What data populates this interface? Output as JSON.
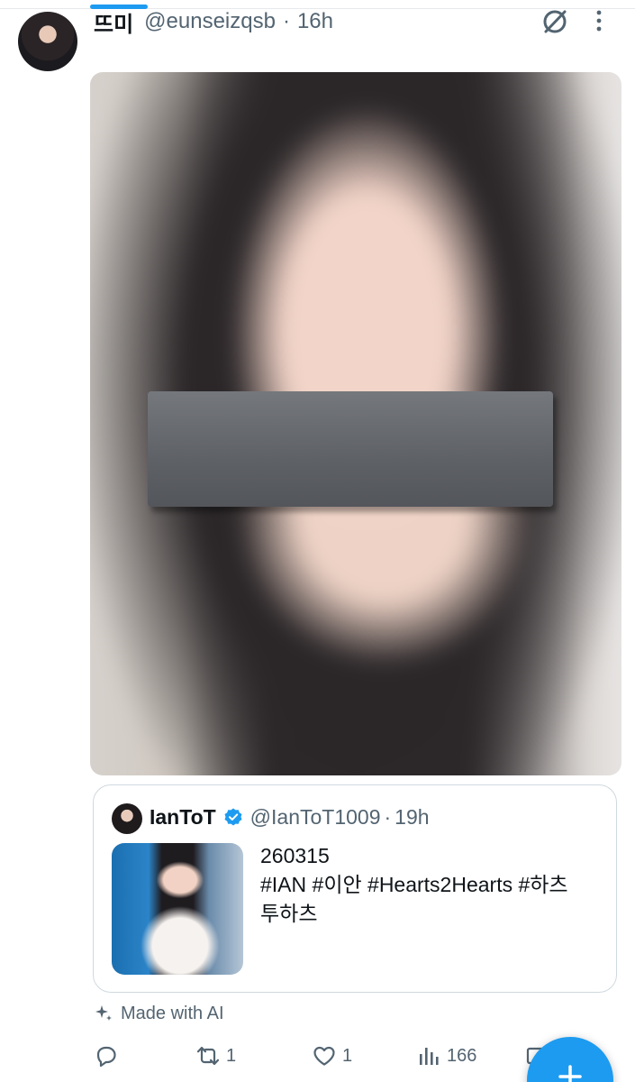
{
  "tweet": {
    "display_name": "뜨미",
    "handle": "@eunseizqsb",
    "separator": "·",
    "time": "16h",
    "avatar_icon": "profile-avatar",
    "menu_icons": [
      "grok-icon",
      "more-vertical-icon"
    ]
  },
  "media": {
    "description_icon": "blurred-photo",
    "censor_color": "#5e6166"
  },
  "quote": {
    "display_name": "IanToT",
    "verified": true,
    "handle": "@IanToT1009",
    "separator": "·",
    "time": "19h",
    "text_line1": "260315",
    "text_line2": "#IAN #이안 #Hearts2Hearts #하츠",
    "text_line3": "투하츠"
  },
  "ai_label": "Made with AI",
  "actions": {
    "reply_count": "",
    "retweet_count": "1",
    "like_count": "1",
    "views_count": "166"
  },
  "colors": {
    "accent": "#1d9bf0",
    "text_primary": "#0f1419",
    "text_secondary": "#536471",
    "border": "#cfd9de"
  }
}
